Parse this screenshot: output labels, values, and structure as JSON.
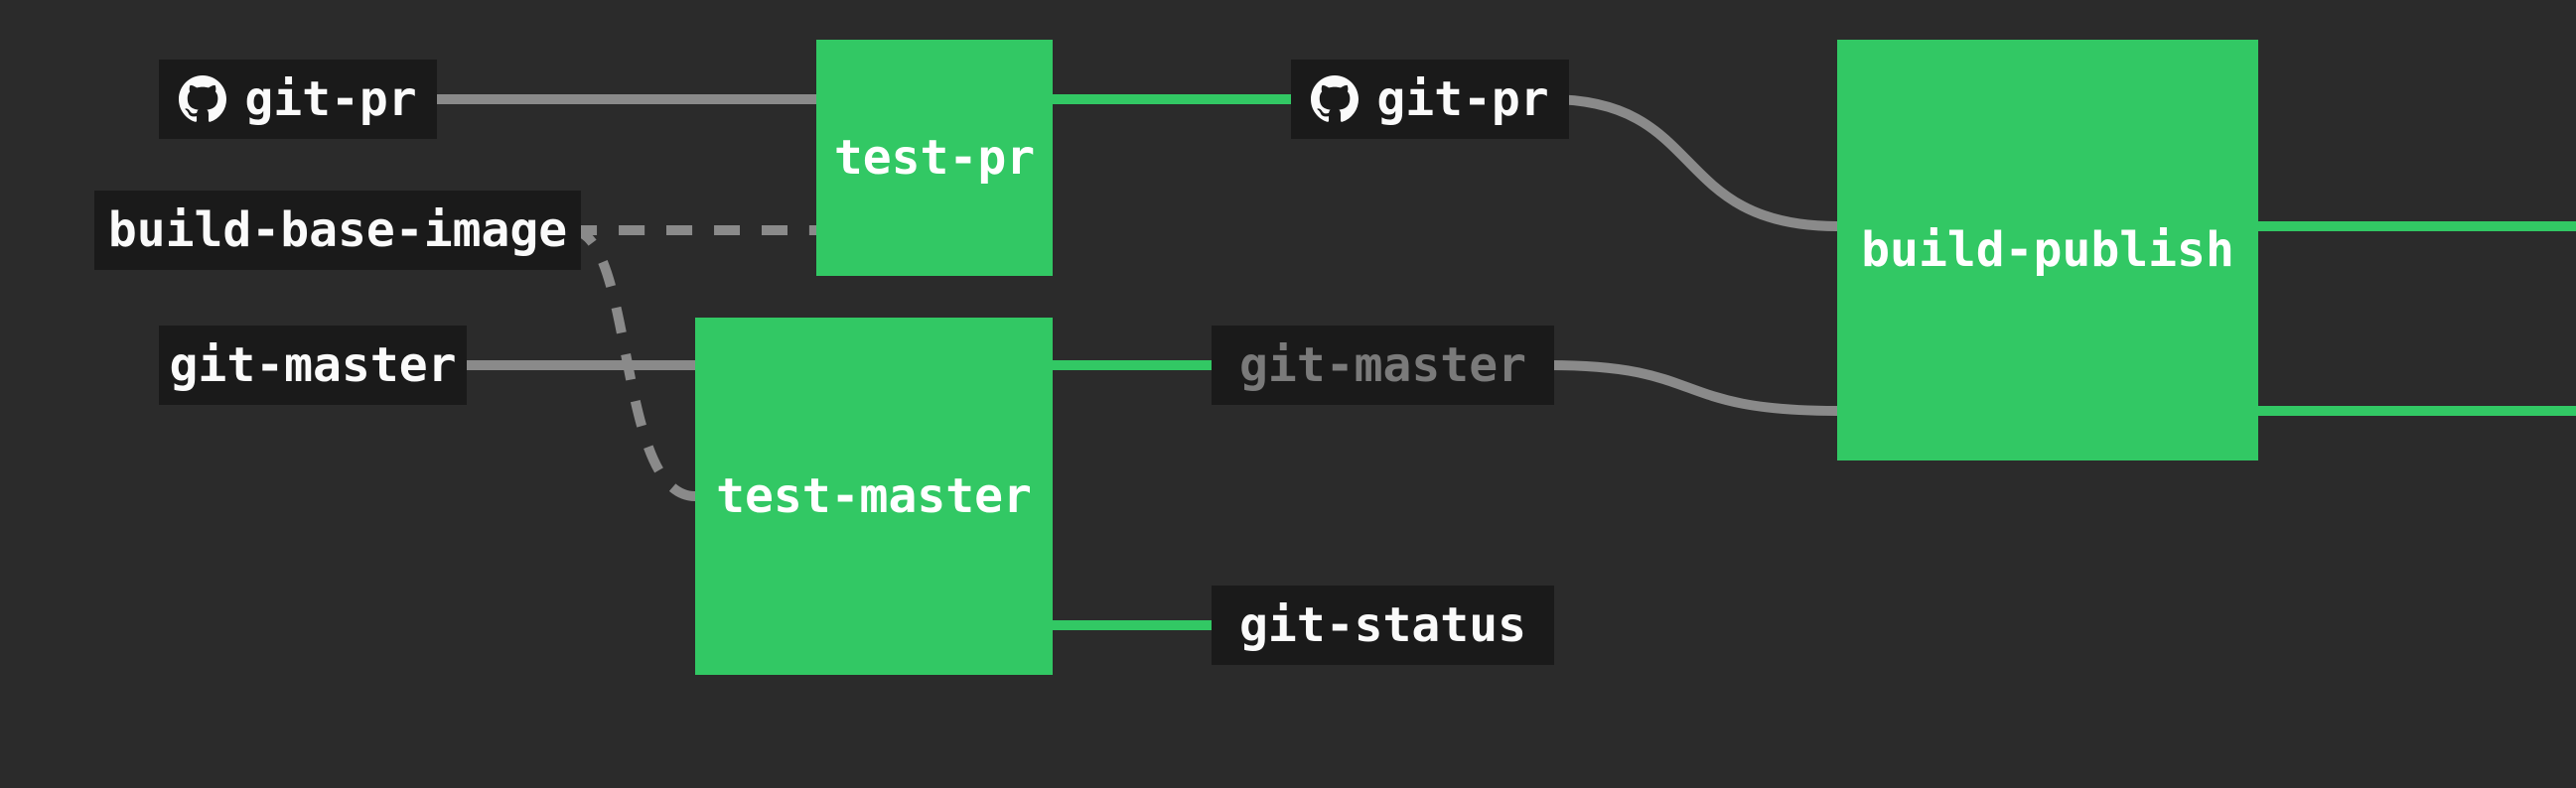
{
  "colors": {
    "bg": "#2b2b2b",
    "node_dark": "#1a1a1a",
    "node_green": "#32c864",
    "text_light": "#fafafa",
    "text_dim": "#7a7a7a",
    "edge_gray": "#8a8a8a",
    "edge_green": "#32c864"
  },
  "resources": {
    "git_pr_in": {
      "label": "git-pr",
      "icon": "github"
    },
    "build_base_image": {
      "label": "build-base-image",
      "icon": null
    },
    "git_master_in": {
      "label": "git-master",
      "icon": null
    },
    "git_pr_out": {
      "label": "git-pr",
      "icon": "github"
    },
    "git_master_out": {
      "label": "git-master",
      "icon": null,
      "dim": true
    },
    "git_status": {
      "label": "git-status",
      "icon": null
    }
  },
  "jobs": {
    "test_pr": {
      "label": "test-pr"
    },
    "test_master": {
      "label": "test-master"
    },
    "build_publish": {
      "label": "build-publish"
    }
  },
  "edges": [
    {
      "from": "git_pr_in",
      "to": "test_pr",
      "style": "solid",
      "color": "gray"
    },
    {
      "from": "build_base_image",
      "to": "test_pr",
      "style": "dashed",
      "color": "gray"
    },
    {
      "from": "build_base_image",
      "to": "test_master",
      "style": "dashed",
      "color": "gray"
    },
    {
      "from": "git_master_in",
      "to": "test_master",
      "style": "solid",
      "color": "gray"
    },
    {
      "from": "test_pr",
      "to": "git_pr_out",
      "style": "solid",
      "color": "green"
    },
    {
      "from": "test_master",
      "to": "git_master_out",
      "style": "solid",
      "color": "green"
    },
    {
      "from": "test_master",
      "to": "git_status",
      "style": "solid",
      "color": "green"
    },
    {
      "from": "git_pr_out",
      "to": "build_publish",
      "style": "solid",
      "color": "gray"
    },
    {
      "from": "git_master_out",
      "to": "build_publish",
      "style": "solid",
      "color": "gray"
    }
  ]
}
